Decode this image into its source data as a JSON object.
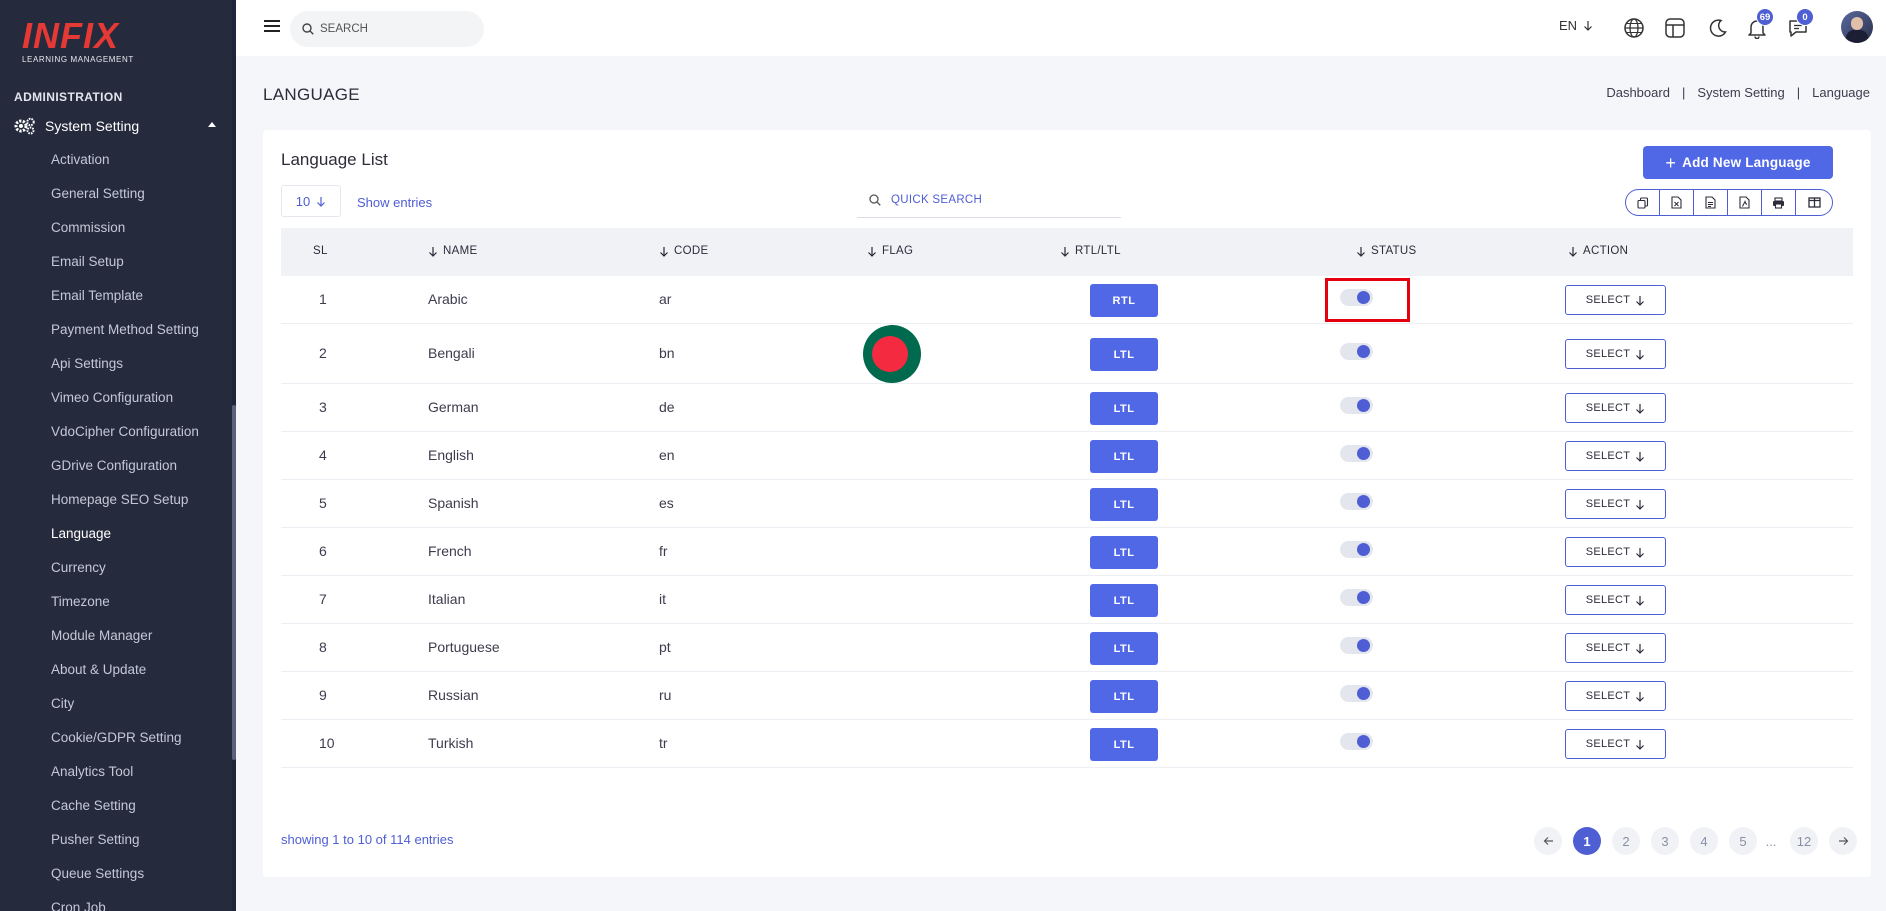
{
  "brand": {
    "logo": "INFIX",
    "subtitle": "LEARNING MANAGEMENT"
  },
  "sidebar": {
    "section": "ADMINISTRATION",
    "group": "System Setting",
    "items": [
      {
        "label": "Activation"
      },
      {
        "label": "General Setting"
      },
      {
        "label": "Commission"
      },
      {
        "label": "Email Setup"
      },
      {
        "label": "Email Template"
      },
      {
        "label": "Payment Method Setting"
      },
      {
        "label": "Api Settings"
      },
      {
        "label": "Vimeo Configuration"
      },
      {
        "label": "VdoCipher Configuration"
      },
      {
        "label": "GDrive Configuration"
      },
      {
        "label": "Homepage SEO Setup"
      },
      {
        "label": "Language"
      },
      {
        "label": "Currency"
      },
      {
        "label": "Timezone"
      },
      {
        "label": "Module Manager"
      },
      {
        "label": "About & Update"
      },
      {
        "label": "City"
      },
      {
        "label": "Cookie/GDPR Setting"
      },
      {
        "label": "Analytics Tool"
      },
      {
        "label": "Cache Setting"
      },
      {
        "label": "Pusher Setting"
      },
      {
        "label": "Queue Settings"
      },
      {
        "label": "Cron Job"
      }
    ],
    "active_item": "Language"
  },
  "topbar": {
    "search_placeholder": "SEARCH",
    "language": "EN",
    "notifications_count": "69",
    "messages_count": "0"
  },
  "page": {
    "title": "LANGUAGE",
    "breadcrumb": [
      "Dashboard",
      "System Setting",
      "Language"
    ]
  },
  "card": {
    "title": "Language List",
    "add_button": "Add New Language",
    "entries_value": "10",
    "entries_label": "Show entries",
    "quick_search_placeholder": "QUICK SEARCH",
    "export_icons": [
      "copy-icon",
      "excel-icon",
      "csv-icon",
      "pdf-icon",
      "print-icon",
      "columns-icon"
    ]
  },
  "table": {
    "columns": [
      "SL",
      "NAME",
      "CODE",
      "FLAG",
      "RTL/LTL",
      "STATUS",
      "ACTION"
    ],
    "action_label": "SELECT",
    "rows": [
      {
        "sl": "1",
        "name": "Arabic",
        "code": "ar",
        "dir": "RTL",
        "status": true,
        "flag": ""
      },
      {
        "sl": "2",
        "name": "Bengali",
        "code": "bn",
        "dir": "LTL",
        "status": true,
        "flag": "bangladesh-flag"
      },
      {
        "sl": "3",
        "name": "German",
        "code": "de",
        "dir": "LTL",
        "status": true,
        "flag": ""
      },
      {
        "sl": "4",
        "name": "English",
        "code": "en",
        "dir": "LTL",
        "status": true,
        "flag": ""
      },
      {
        "sl": "5",
        "name": "Spanish",
        "code": "es",
        "dir": "LTL",
        "status": true,
        "flag": ""
      },
      {
        "sl": "6",
        "name": "French",
        "code": "fr",
        "dir": "LTL",
        "status": true,
        "flag": ""
      },
      {
        "sl": "7",
        "name": "Italian",
        "code": "it",
        "dir": "LTL",
        "status": true,
        "flag": ""
      },
      {
        "sl": "8",
        "name": "Portuguese",
        "code": "pt",
        "dir": "LTL",
        "status": true,
        "flag": ""
      },
      {
        "sl": "9",
        "name": "Russian",
        "code": "ru",
        "dir": "LTL",
        "status": true,
        "flag": ""
      },
      {
        "sl": "10",
        "name": "Turkish",
        "code": "tr",
        "dir": "LTL",
        "status": true,
        "flag": ""
      }
    ]
  },
  "footer": {
    "showing": "showing 1 to 10 of 114 entries",
    "pages": [
      "1",
      "2",
      "3",
      "4",
      "5",
      "...",
      "12"
    ],
    "current_page": "1"
  },
  "colors": {
    "accent": "#5067e6",
    "sidebar_bg": "#252b3d",
    "highlight": "#e5000f",
    "logo": "#e53935"
  }
}
